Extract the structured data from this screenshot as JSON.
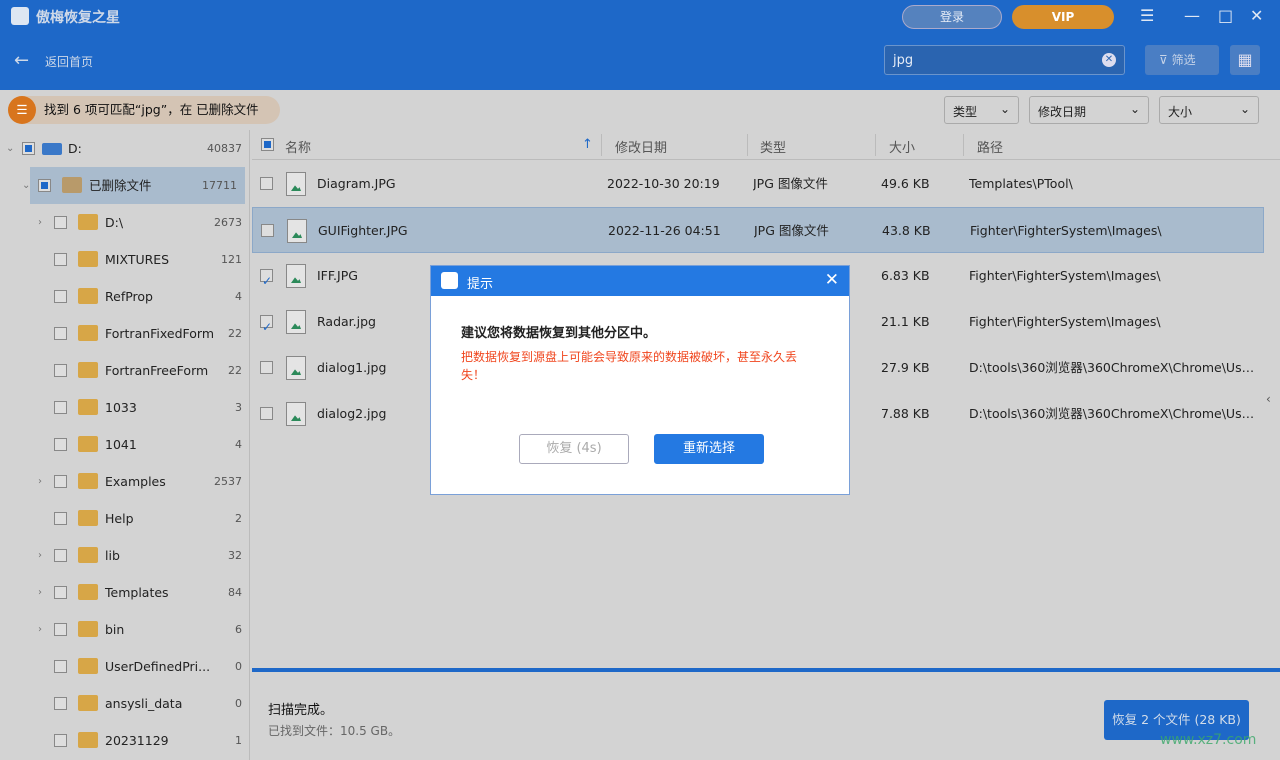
{
  "app": {
    "title": "傲梅恢复之星",
    "login": "登录",
    "vip": "VIP",
    "back": "返回首页",
    "search_value": "jpg",
    "filter": "筛选"
  },
  "found_banner": "找到 6 项可匹配“jpg”，在 已删除文件",
  "dropdowns": [
    "类型",
    "修改日期",
    "大小"
  ],
  "tree": [
    {
      "label": "D:",
      "count": "40837",
      "level": 0,
      "expand": true,
      "check": "part"
    },
    {
      "label": "已删除文件",
      "count": "17711",
      "level": 1,
      "expand": true,
      "check": "part",
      "selected": true
    },
    {
      "label": "D:\\",
      "count": "2673",
      "level": 2,
      "expand": false
    },
    {
      "label": "MIXTURES",
      "count": "121",
      "level": 2
    },
    {
      "label": "RefProp",
      "count": "4",
      "level": 2
    },
    {
      "label": "FortranFixedForm",
      "count": "22",
      "level": 2
    },
    {
      "label": "FortranFreeForm",
      "count": "22",
      "level": 2
    },
    {
      "label": "1033",
      "count": "3",
      "level": 2
    },
    {
      "label": "1041",
      "count": "4",
      "level": 2
    },
    {
      "label": "Examples",
      "count": "2537",
      "level": 2,
      "expand": false
    },
    {
      "label": "Help",
      "count": "2",
      "level": 2
    },
    {
      "label": "lib",
      "count": "32",
      "level": 2,
      "expand": false
    },
    {
      "label": "Templates",
      "count": "84",
      "level": 2,
      "expand": false
    },
    {
      "label": "bin",
      "count": "6",
      "level": 2,
      "expand": false
    },
    {
      "label": "UserDefinedPri...",
      "count": "0",
      "level": 2
    },
    {
      "label": "ansysli_data",
      "count": "0",
      "level": 2
    },
    {
      "label": "20231129",
      "count": "1",
      "level": 2
    }
  ],
  "columns": {
    "name": "名称",
    "date": "修改日期",
    "type": "类型",
    "size": "大小",
    "path": "路径"
  },
  "files": [
    {
      "name": "Diagram.JPG",
      "date": "2022-10-30 20:19",
      "type": "JPG 图像文件",
      "size": "49.6 KB",
      "path": "Templates\\PTool\\",
      "checked": false
    },
    {
      "name": "GUIFighter.JPG",
      "date": "2022-11-26 04:51",
      "type": "JPG 图像文件",
      "size": "43.8 KB",
      "path": "Fighter\\FighterSystem\\Images\\",
      "checked": false,
      "selected": true
    },
    {
      "name": "IFF.JPG",
      "date": "",
      "type": "",
      "size": "6.83 KB",
      "path": "Fighter\\FighterSystem\\Images\\",
      "checked": true
    },
    {
      "name": "Radar.jpg",
      "date": "",
      "type": "",
      "size": "21.1 KB",
      "path": "Fighter\\FighterSystem\\Images\\",
      "checked": true
    },
    {
      "name": "dialog1.jpg",
      "date": "",
      "type": "",
      "size": "27.9 KB",
      "path": "D:\\tools\\360浏览器\\360ChromeX\\Chrome\\User ...",
      "checked": false
    },
    {
      "name": "dialog2.jpg",
      "date": "",
      "type": "",
      "size": "7.88 KB",
      "path": "D:\\tools\\360浏览器\\360ChromeX\\Chrome\\User ...",
      "checked": false
    }
  ],
  "status": {
    "scan": "扫描完成。",
    "found": "已找到文件：10.5 GB。",
    "recover": "恢复 2 个文件 (28 KB)"
  },
  "dialog": {
    "title": "提示",
    "main": "建议您将数据恢复到其他分区中。",
    "warning": "把数据恢复到源盘上可能会导致原来的数据被破坏，甚至永久丢失！",
    "recover": "恢复 (4s)",
    "reselect": "重新选择"
  },
  "watermark": "www.xz7.com"
}
